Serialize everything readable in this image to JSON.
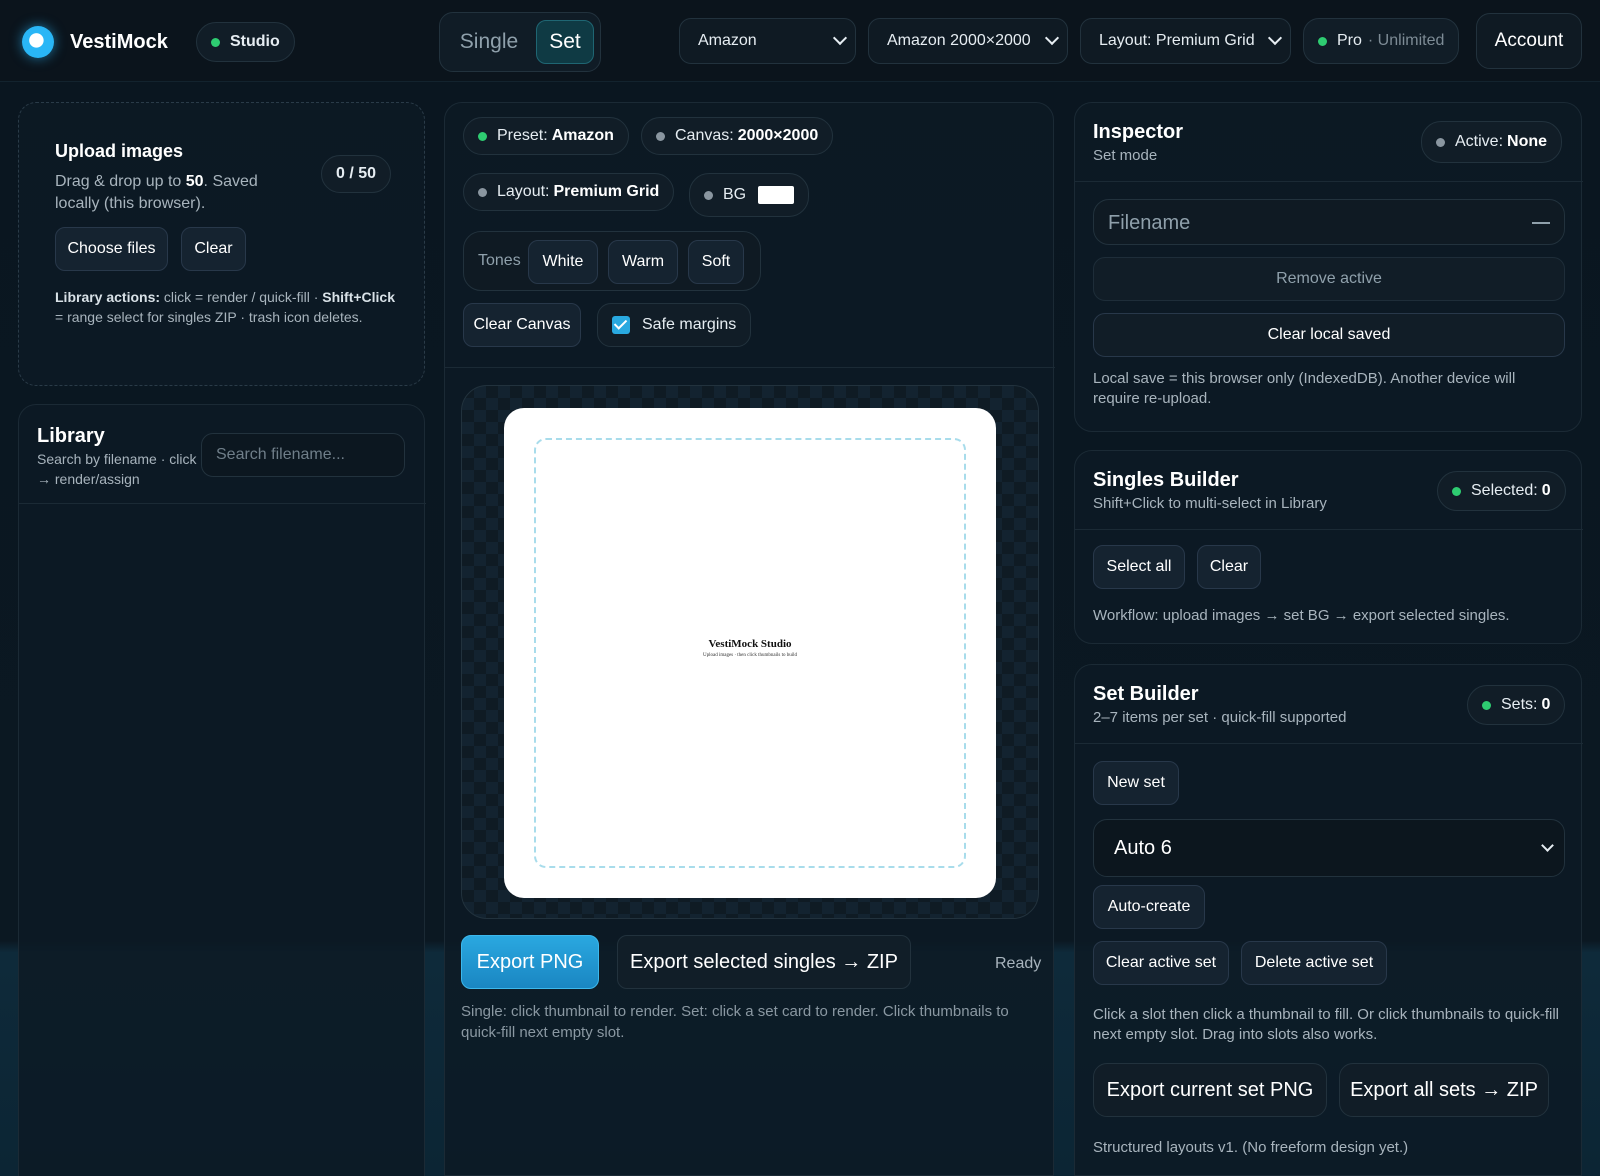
{
  "app": {
    "brand": "VestiMock",
    "studio_badge": "Studio",
    "mode_single": "Single",
    "mode_set": "Set",
    "marketplace_select": "Amazon",
    "size_select": "Amazon 2000×2000",
    "layout_select": "Layout: Premium Grid",
    "plan_label": "Pro",
    "plan_detail": "· Unlimited",
    "account_label": "Account"
  },
  "upload": {
    "title": "Upload images",
    "desc_prefix": "Drag & drop up to ",
    "desc_limit": "50",
    "desc_suffix": ". Saved locally (this browser).",
    "count": "0 / 50",
    "choose_files": "Choose files",
    "clear": "Clear",
    "help_label1": "Library actions:",
    "help_text1": " click = render / quick-fill · ",
    "help_label2": "Shift+Click",
    "help_text2": " = range select for singles ZIP · trash icon deletes."
  },
  "library": {
    "title": "Library",
    "subtitle": "Search by filename · click → render/assign",
    "search_placeholder": "Search filename..."
  },
  "canvas_panel": {
    "preset_label": "Preset:",
    "preset_value": "Amazon",
    "canvas_label": "Canvas:",
    "canvas_value": "2000×2000",
    "layout_label": "Layout:",
    "layout_value": "Premium Grid",
    "bg_label": "BG",
    "bg_color": "#ffffff",
    "tones_label": "Tones",
    "tones": [
      "White",
      "Warm",
      "Soft"
    ],
    "clear_canvas": "Clear Canvas",
    "safe_margins": "Safe margins",
    "preview_title": "VestiMock Studio",
    "preview_subtitle": "Upload images · then click thumbnails to build",
    "export_png": "Export PNG",
    "export_zip": "Export selected singles → ZIP",
    "status": "Ready",
    "help": "Single: click thumbnail to render. Set: click a set card to render. Click thumbnails to quick-fill next empty slot."
  },
  "inspector": {
    "title": "Inspector",
    "subtitle": "Set mode",
    "active_label": "Active:",
    "active_value": "None",
    "filename_placeholder": "Filename",
    "remove_active": "Remove active",
    "clear_local": "Clear local saved",
    "help": "Local save = this browser only (IndexedDB). Another device will require re-upload."
  },
  "singles": {
    "title": "Singles Builder",
    "subtitle": "Shift+Click to multi-select in Library",
    "selected_label": "Selected:",
    "selected_value": "0",
    "select_all": "Select all",
    "clear": "Clear",
    "help": "Workflow: upload images → set BG → export selected singles."
  },
  "setbuilder": {
    "title": "Set Builder",
    "subtitle": "2–7 items per set · quick-fill supported",
    "sets_label": "Sets:",
    "sets_value": "0",
    "new_set": "New set",
    "auto_option": "Auto 6",
    "auto_create": "Auto-create",
    "clear_active": "Clear active set",
    "delete_active": "Delete active set",
    "help": "Click a slot then click a thumbnail to fill. Or click thumbnails to quick-fill next empty slot. Drag into slots also works.",
    "export_current": "Export current set PNG",
    "export_all": "Export all sets → ZIP",
    "footnote": "Structured layouts v1. (No freeform design yet.)"
  },
  "colors": {
    "accent": "#29a9e0",
    "status_green": "#2ecc71",
    "background": "#08151f"
  }
}
